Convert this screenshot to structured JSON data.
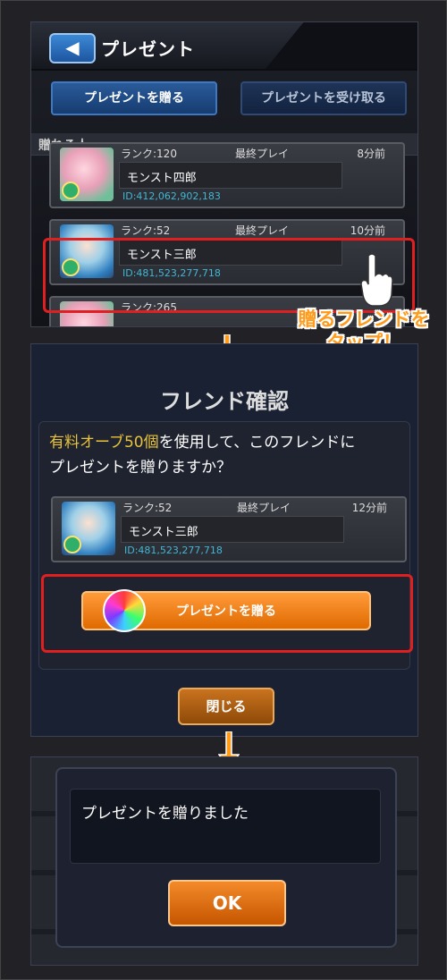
{
  "header": {
    "title": "プレゼント",
    "back_icon": "◀"
  },
  "tabs": {
    "send": "プレゼントを贈る",
    "receive": "プレゼントを受け取る"
  },
  "section_label": "贈れる人",
  "friends": [
    {
      "rank": "ランク:120",
      "last_play_label": "最終プレイ",
      "last_play": "8分前",
      "name": "モンスト四郎",
      "id": "ID:412,062,902,183"
    },
    {
      "rank": "ランク:52",
      "last_play_label": "最終プレイ",
      "last_play": "10分前",
      "name": "モンスト三郎",
      "id": "ID:481,523,277,718"
    },
    {
      "rank": "ランク:265"
    }
  ],
  "callout": {
    "line1": "贈るフレンドを",
    "line2": "タップ！"
  },
  "confirm": {
    "title": "フレンド確認",
    "message_highlight": "有料オーブ50個",
    "message_rest1": "を使用して、このフレンドに",
    "message_rest2": "プレゼントを贈りますか？",
    "friend": {
      "rank": "ランク:52",
      "last_play_label": "最終プレイ",
      "last_play": "12分前",
      "name": "モンスト三郎",
      "id": "ID:481,523,277,718"
    },
    "send_button": "プレゼントを贈る",
    "close_button": "閉じる"
  },
  "result": {
    "message": "プレゼントを贈りました",
    "ok_button": "OK"
  },
  "colors": {
    "highlight_red": "#e02020",
    "accent_orange": "#ff9a1a",
    "id_cyan": "#3fb8d6"
  }
}
